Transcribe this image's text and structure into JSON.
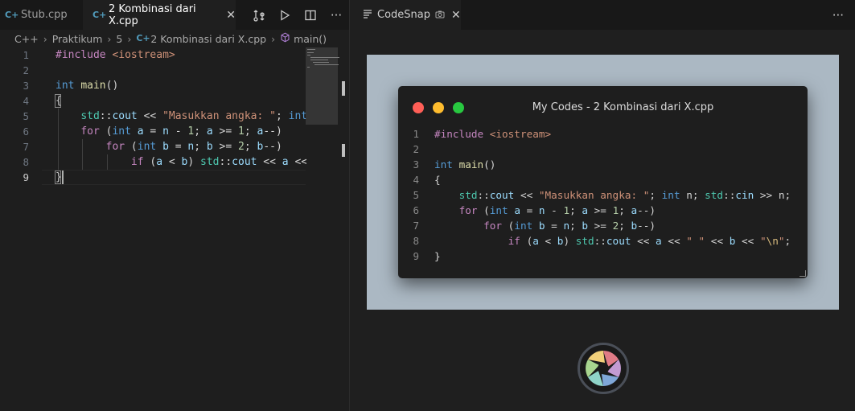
{
  "left_tabs": [
    {
      "label": "Stub.cpp",
      "active": false
    },
    {
      "label": "2 Kombinasi dari X.cpp",
      "active": true
    }
  ],
  "breadcrumb": [
    "C++",
    "Praktikum",
    "5",
    "2 Kombinasi dari X.cpp",
    "main()"
  ],
  "editor": {
    "line_numbers": [
      "1",
      "2",
      "3",
      "4",
      "5",
      "6",
      "7",
      "8",
      "9"
    ],
    "current_line": "9"
  },
  "right_tab": {
    "label": "CodeSnap"
  },
  "snap": {
    "title": "My Codes - 2 Kombinasi dari X.cpp",
    "line_numbers": [
      "1",
      "2",
      "3",
      "4",
      "5",
      "6",
      "7",
      "8",
      "9"
    ]
  },
  "colors": {
    "red_dot": "#ff5f57",
    "yellow_dot": "#febc2e",
    "green_dot": "#28c840",
    "frame_bg": "#abb8c3"
  },
  "icons": [
    "cpp-file-icon",
    "close-icon",
    "compare-changes-icon",
    "run-icon",
    "split-editor-icon",
    "more-actions-icon",
    "cube-method-icon",
    "codesnap-icon",
    "camera-shutter-icon"
  ]
}
